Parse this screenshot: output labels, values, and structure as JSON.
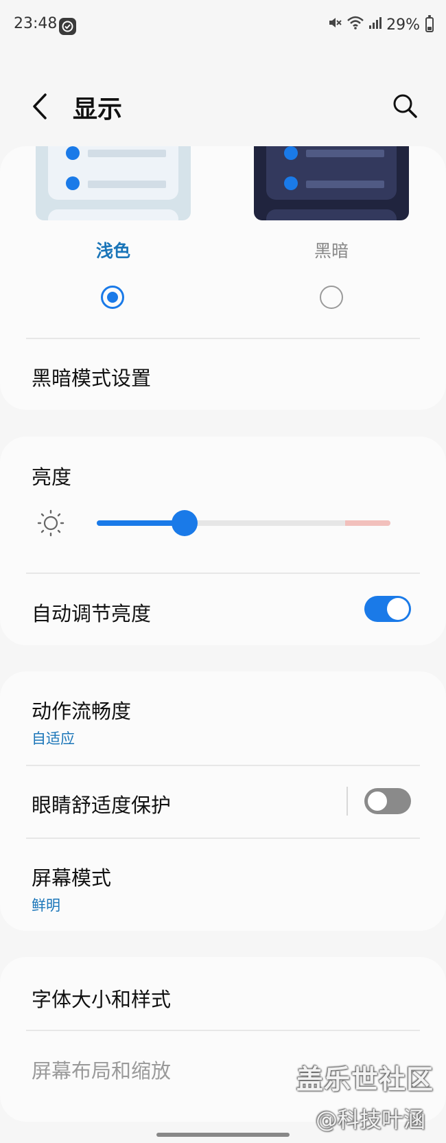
{
  "status_bar": {
    "time": "23:48",
    "battery": "29%",
    "battery_level": 0.29
  },
  "header": {
    "title": "显示"
  },
  "theme": {
    "light_label": "浅色",
    "dark_label": "黑暗",
    "selected": "light",
    "dark_mode_settings_label": "黑暗模式设置"
  },
  "brightness": {
    "title": "亮度",
    "level": 0.3,
    "auto_label": "自动调节亮度",
    "auto_enabled": true
  },
  "motion": {
    "label": "动作流畅度",
    "value": "自适应"
  },
  "eye_comfort": {
    "label": "眼睛舒适度保护",
    "enabled": false
  },
  "screen_mode": {
    "label": "屏幕模式",
    "value": "鲜明"
  },
  "font": {
    "label": "字体大小和样式"
  },
  "layout": {
    "label": "屏幕布局和缩放"
  },
  "watermark": {
    "line1": "盖乐世社区",
    "line2": "@科技叶涵"
  },
  "colors": {
    "accent": "#1a7ae8",
    "subtext": "#1a75b8",
    "background": "#f6f6f6",
    "card": "#fbfbfb"
  }
}
